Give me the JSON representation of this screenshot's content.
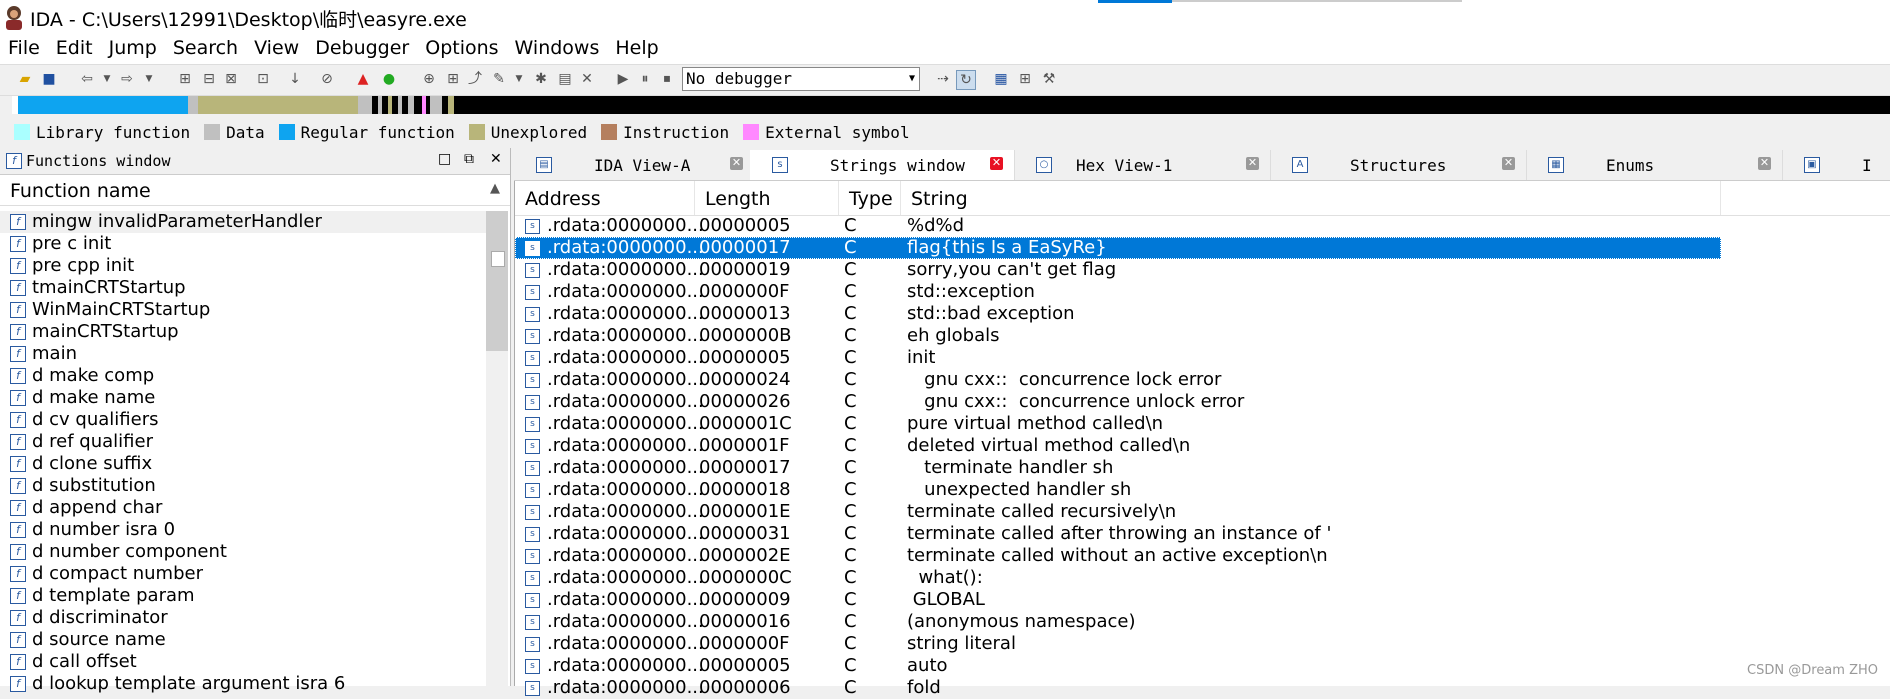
{
  "window": {
    "title": "IDA - C:\\Users\\12991\\Desktop\\临时\\easyre.exe"
  },
  "menu": [
    "File",
    "Edit",
    "Jump",
    "Search",
    "View",
    "Debugger",
    "Options",
    "Windows",
    "Help"
  ],
  "toolbar": {
    "debugger_select": "No debugger"
  },
  "legend": [
    {
      "label": "Library function",
      "color": "#aaffff"
    },
    {
      "label": "Data",
      "color": "#c0c0c0"
    },
    {
      "label": "Regular function",
      "color": "#0ea4f0"
    },
    {
      "label": "Unexplored",
      "color": "#b8b57a"
    },
    {
      "label": "Instruction",
      "color": "#b57f5e"
    },
    {
      "label": "External symbol",
      "color": "#ff88ff"
    }
  ],
  "functions_window": {
    "title": "Functions window",
    "column": "Function name",
    "items": [
      "  mingw invalidParameterHandler",
      "pre c init",
      "pre cpp init",
      "  tmainCRTStartup",
      "WinMainCRTStartup",
      "mainCRTStartup",
      "main",
      "d make comp",
      "d make name",
      "d cv qualifiers",
      "d ref qualifier",
      "d clone suffix",
      "d substitution",
      "d append char",
      "d number isra 0",
      "d number component",
      "d compact number",
      "d template param",
      "d discriminator",
      "d source name",
      "d call offset",
      "d lookup template argument isra 6"
    ]
  },
  "tabs": [
    {
      "label": "IDA View-A",
      "icon": "ida-view-icon",
      "active": false
    },
    {
      "label": "Strings window",
      "icon": "strings-icon",
      "active": true
    },
    {
      "label": "Hex View-1",
      "icon": "hex-view-icon",
      "active": false
    },
    {
      "label": "Structures",
      "icon": "structures-icon",
      "active": false
    },
    {
      "label": "Enums",
      "icon": "enums-icon",
      "active": false
    },
    {
      "label": "I",
      "icon": "imports-icon",
      "active": false
    }
  ],
  "strings_window": {
    "columns": [
      "Address",
      "Length",
      "Type",
      "String"
    ],
    "rows": [
      [
        ".rdata:0000000...",
        "00000005",
        "C",
        "%d%d"
      ],
      [
        ".rdata:0000000...",
        "00000017",
        "C",
        "flag{this Is a EaSyRe}"
      ],
      [
        ".rdata:0000000...",
        "00000019",
        "C",
        "sorry,you can't get flag"
      ],
      [
        ".rdata:0000000...",
        "0000000F",
        "C",
        "std::exception"
      ],
      [
        ".rdata:0000000...",
        "00000013",
        "C",
        "std::bad exception"
      ],
      [
        ".rdata:0000000...",
        "0000000B",
        "C",
        "eh globals"
      ],
      [
        ".rdata:0000000...",
        "00000005",
        "C",
        "init"
      ],
      [
        ".rdata:0000000...",
        "00000024",
        "C",
        "   gnu cxx::  concurrence lock error"
      ],
      [
        ".rdata:0000000...",
        "00000026",
        "C",
        "   gnu cxx::  concurrence unlock error"
      ],
      [
        ".rdata:0000000...",
        "0000001C",
        "C",
        "pure virtual method called\\n"
      ],
      [
        ".rdata:0000000...",
        "0000001F",
        "C",
        "deleted virtual method called\\n"
      ],
      [
        ".rdata:0000000...",
        "00000017",
        "C",
        "   terminate handler sh"
      ],
      [
        ".rdata:0000000...",
        "00000018",
        "C",
        "   unexpected handler sh"
      ],
      [
        ".rdata:0000000...",
        "0000001E",
        "C",
        "terminate called recursively\\n"
      ],
      [
        ".rdata:0000000...",
        "00000031",
        "C",
        "terminate called after throwing an instance of '"
      ],
      [
        ".rdata:0000000...",
        "0000002E",
        "C",
        "terminate called without an active exception\\n"
      ],
      [
        ".rdata:0000000...",
        "0000000C",
        "C",
        "  what():"
      ],
      [
        ".rdata:0000000...",
        "00000009",
        "C",
        " GLOBAL"
      ],
      [
        ".rdata:0000000...",
        "00000016",
        "C",
        "(anonymous namespace)"
      ],
      [
        ".rdata:0000000...",
        "0000000F",
        "C",
        "string literal"
      ],
      [
        ".rdata:0000000...",
        "00000005",
        "C",
        "auto"
      ],
      [
        ".rdata:0000000...",
        "00000006",
        "C",
        "fold"
      ]
    ],
    "selected_index": 1
  },
  "watermark": "CSDN @Dream ZHO"
}
